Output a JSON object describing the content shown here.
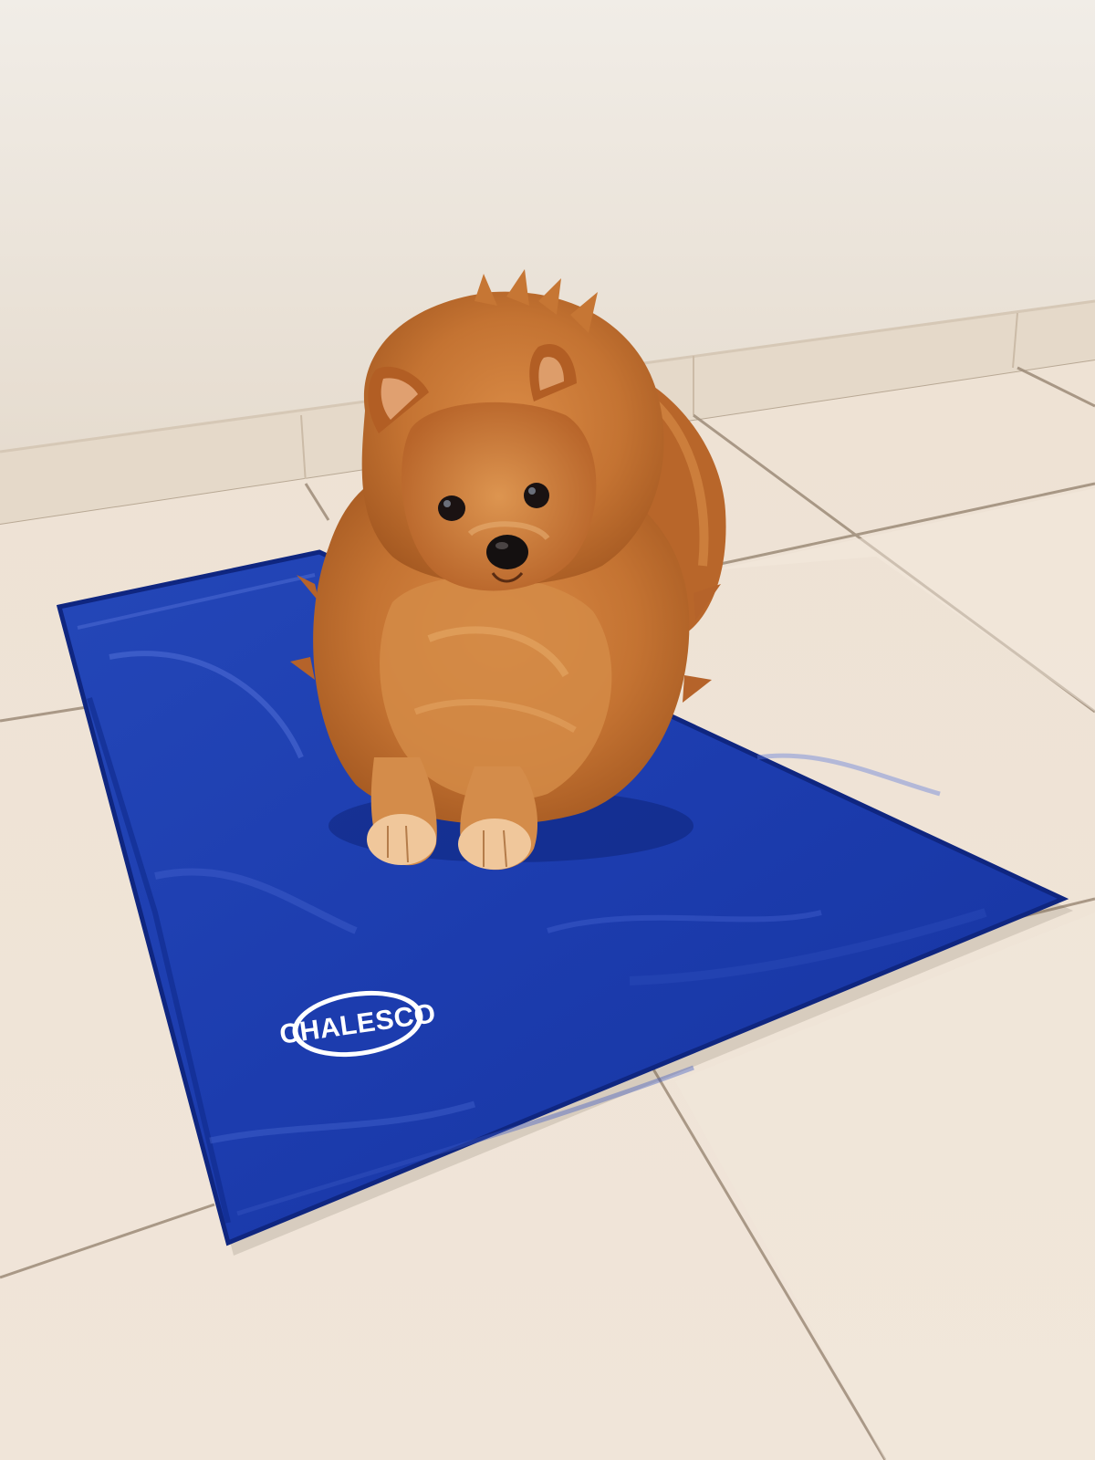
{
  "photo": {
    "subject": "pomeranian-dog",
    "object": "cooling-mat",
    "mat_brand_logo_text": "CHALESCO"
  },
  "colors": {
    "wall": "#ece6dd",
    "baseboard": "#e7dccd",
    "floor_tile": "#efe3d6",
    "grout": "#9a8a7a",
    "mat_blue": "#1c3eb0",
    "mat_blue_dark": "#0f2680",
    "mat_highlight": "#4f6fd6",
    "fur_orange": "#c9772f",
    "fur_light": "#e5a868",
    "fur_dark": "#8e4a1b",
    "nose": "#141010",
    "logo_white": "#ffffff"
  }
}
